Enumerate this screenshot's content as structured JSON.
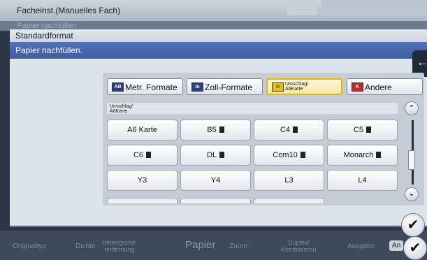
{
  "background": {
    "title": "Facheinst.(Manuelles Fach)",
    "subtitle": "Papier nachfüllen",
    "bottom_labels": [
      "Originaltyp",
      "Dichte",
      "Hintergrund-\nentfernung",
      "Papier",
      "Zoom",
      "Duplex/\nKombinieren",
      "Ausgabe",
      "An"
    ]
  },
  "dialog": {
    "title": "Standardformat",
    "message": "Papier nachfüllen.",
    "back_arrow": "←"
  },
  "tabs": [
    {
      "icon": "AB",
      "label": "Metr. Formate"
    },
    {
      "icon": "In",
      "label": "Zoll-Formate"
    },
    {
      "icon": "✉",
      "label": "Umschlag/\nA6Karte"
    },
    {
      "icon": "K",
      "label": "Andere"
    }
  ],
  "group_label": "Umschlag/\nA6Karte",
  "sizes": [
    {
      "label": "A6 Karte",
      "orient": false
    },
    {
      "label": "B5",
      "orient": true
    },
    {
      "label": "C4",
      "orient": true
    },
    {
      "label": "C5",
      "orient": true
    },
    {
      "label": "C6",
      "orient": true
    },
    {
      "label": "DL",
      "orient": true
    },
    {
      "label": "Com10",
      "orient": true
    },
    {
      "label": "Monarch",
      "orient": true
    },
    {
      "label": "Y3",
      "orient": false
    },
    {
      "label": "Y4",
      "orient": false
    },
    {
      "label": "L3",
      "orient": false
    },
    {
      "label": "L4",
      "orient": false
    }
  ],
  "scroll": {
    "up": "⌃",
    "down": "⌄"
  },
  "ok_glyph": "✔",
  "colors": {
    "accent": "#e4b800",
    "header_blue": "#4664aa"
  }
}
